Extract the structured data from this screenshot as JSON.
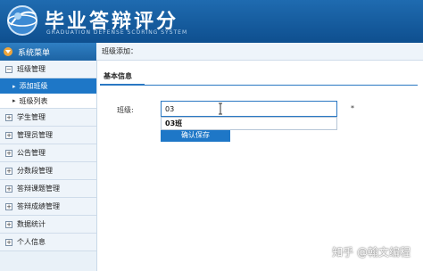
{
  "header": {
    "title": "毕业答辩评分",
    "subtitle": "GRADUATION DEFENSE SCORING SYSTEM"
  },
  "sidebar": {
    "title": "系统菜单",
    "groups": [
      {
        "label": "班级管理",
        "expanded": true,
        "items": [
          {
            "label": "添加班级",
            "active": true
          },
          {
            "label": "班级列表",
            "active": false
          }
        ]
      },
      {
        "label": "学生管理"
      },
      {
        "label": "管理员管理"
      },
      {
        "label": "公告管理"
      },
      {
        "label": "分数段管理"
      },
      {
        "label": "答辩课题管理"
      },
      {
        "label": "答辩成绩管理"
      },
      {
        "label": "数据统计"
      },
      {
        "label": "个人信息"
      }
    ]
  },
  "breadcrumb": "班级添加：",
  "section": {
    "title": "基本信息"
  },
  "form": {
    "class_label": "班级:",
    "class_value": "03",
    "required_mark": "*",
    "autocomplete_suggestion": "03班",
    "save_label": "确认保存"
  },
  "watermark": "知乎 @翰文编程",
  "colors": {
    "header": "#1f6bb0",
    "accent": "#1e77c7"
  }
}
